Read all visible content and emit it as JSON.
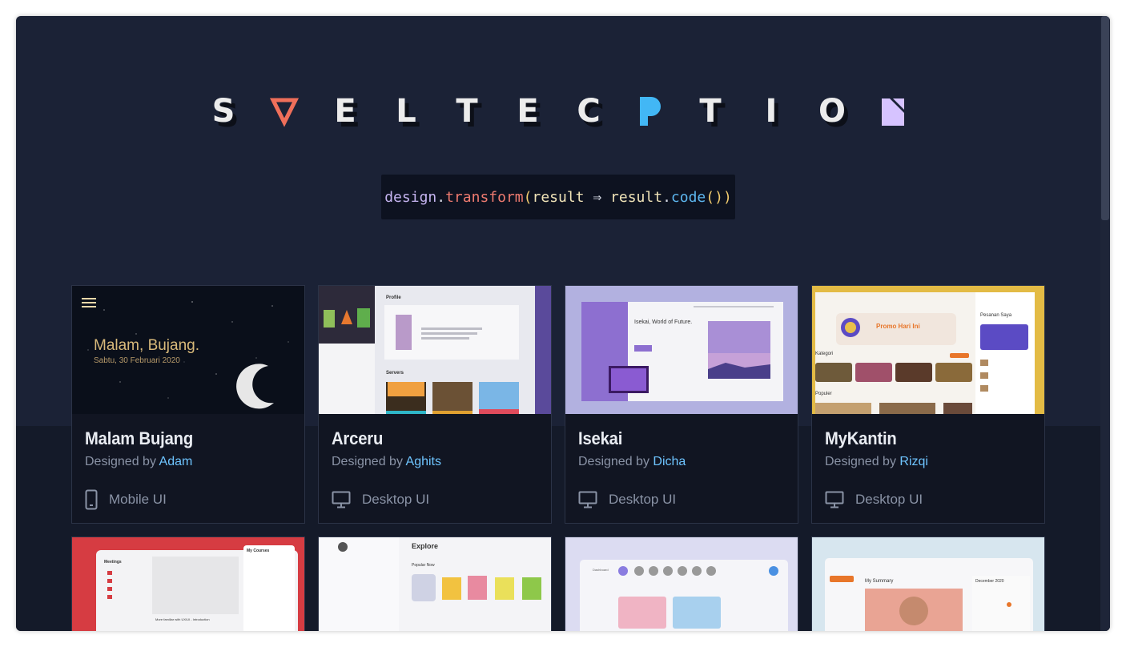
{
  "logo": {
    "letters": [
      "S",
      "",
      "E",
      "L",
      "T",
      "E",
      "C",
      "",
      "T",
      "I",
      "O",
      ""
    ],
    "icons": {
      "1": "svelte-triangle-icon",
      "7": "p-shape-icon",
      "11": "n-shape-icon"
    },
    "icon_colors": {
      "triangle": "#ef6f5a",
      "p": "#42b7f5",
      "n": "#d6c3ff"
    }
  },
  "tagline": {
    "design": "design",
    "dot1": ".",
    "transform": "transform",
    "open": "(",
    "result1": "result",
    "arrow": " ⇒ ",
    "result2": "result",
    "dot2": ".",
    "code": "code",
    "close": "())"
  },
  "cards": [
    {
      "title": "Malam Bujang",
      "designed_by": "Designed by",
      "author": "Adam",
      "kind": "Mobile UI",
      "kind_icon": "mobile-phone-icon",
      "preview": {
        "greeting": "Malam, Bujang.",
        "date": "Sabtu, 30 Februari 2020"
      }
    },
    {
      "title": "Arceru",
      "designed_by": "Designed by",
      "author": "Aghits",
      "kind": "Desktop UI",
      "kind_icon": "desktop-monitor-icon",
      "preview": {
        "heading": "Profile",
        "servers": "Servers"
      }
    },
    {
      "title": "Isekai",
      "designed_by": "Designed by",
      "author": "Dicha",
      "kind": "Desktop UI",
      "kind_icon": "desktop-monitor-icon",
      "preview": {
        "heading": "Isekai, World of Future."
      }
    },
    {
      "title": "MyKantin",
      "designed_by": "Designed by",
      "author": "Rizqi",
      "kind": "Desktop UI",
      "kind_icon": "desktop-monitor-icon",
      "preview": {
        "promo": "Promo Hari Ini",
        "kategori": "Kategori",
        "populer": "Populer",
        "pesanan": "Pesanan Saya"
      }
    }
  ],
  "partial_cards": [
    {
      "preview": {
        "left_title": "Meetings",
        "right_title": "My Courses",
        "caption": "More familiar with UX/UI - Introduction"
      }
    },
    {
      "preview": {
        "heading": "Explore",
        "sub": "Popular Now"
      }
    },
    {
      "preview": {
        "heading": "Dashboard"
      }
    },
    {
      "preview": {
        "heading": "My Summary",
        "calendar": "December 2020"
      }
    }
  ]
}
